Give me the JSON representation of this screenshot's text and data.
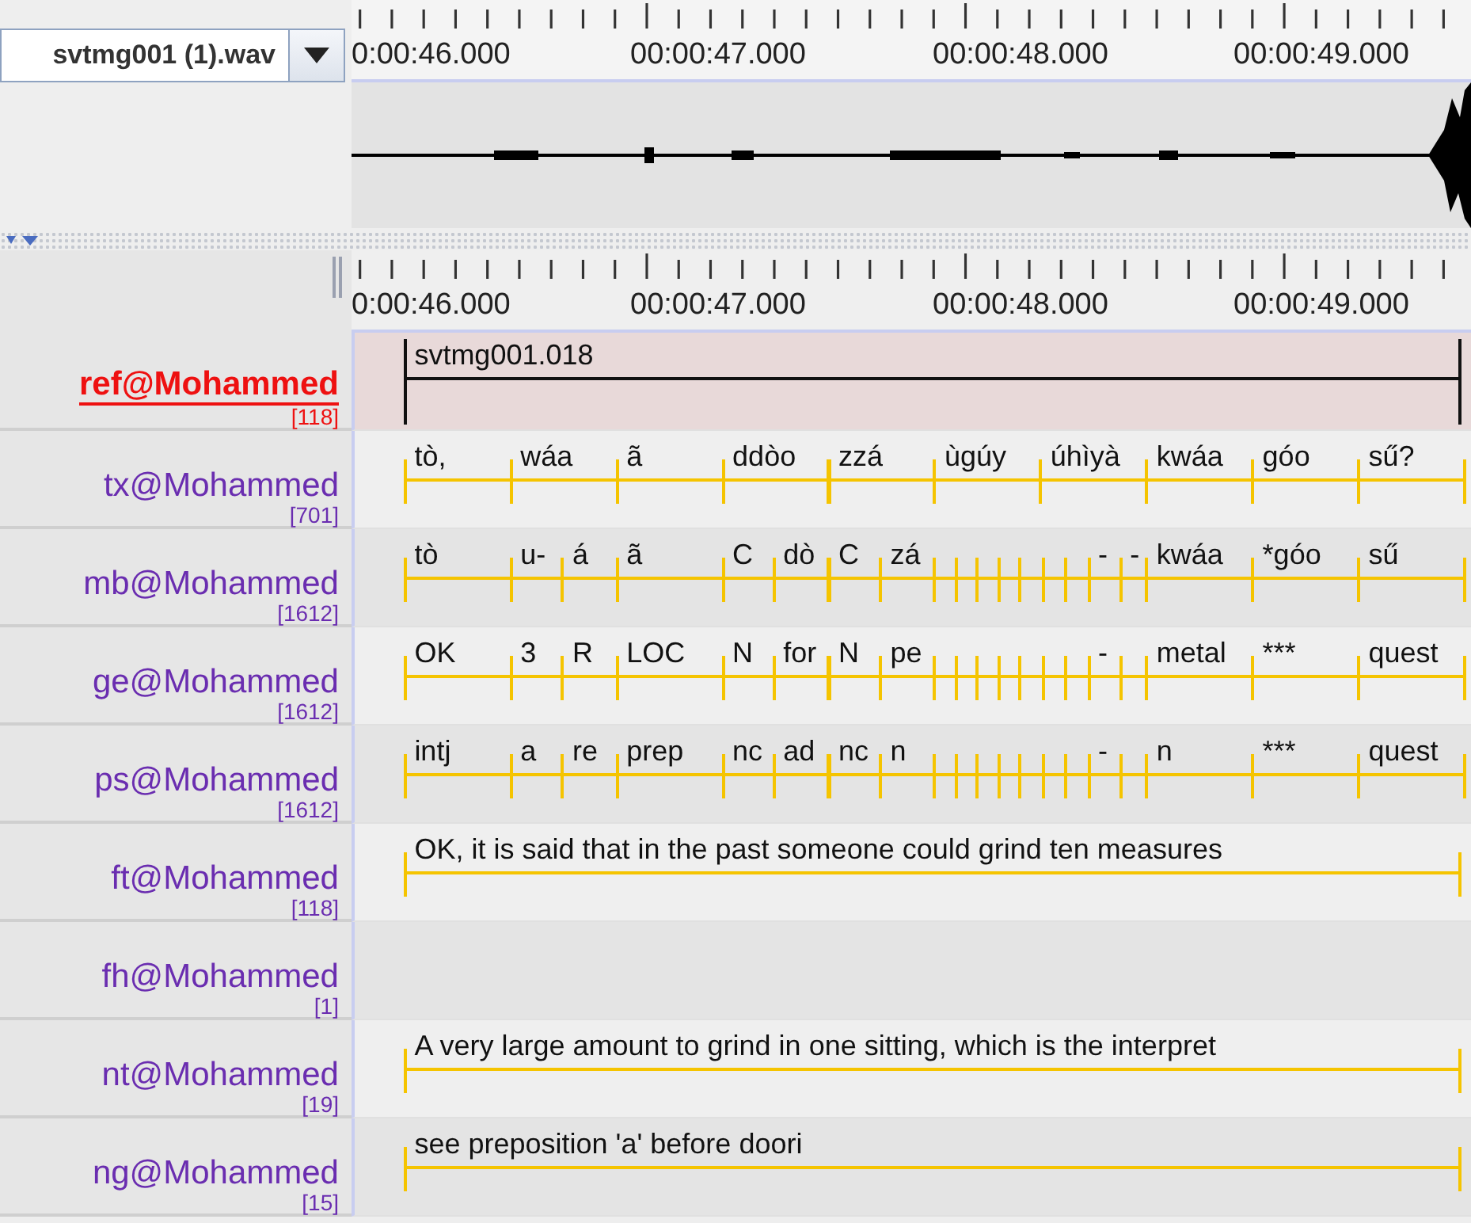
{
  "media_selector": {
    "value": "svtmg001 (1).wav"
  },
  "top_ruler": {
    "labels": [
      "0:00:46.000",
      "00:00:47.000",
      "00:00:48.000",
      "00:00:49.000"
    ]
  },
  "bottom_ruler": {
    "labels": [
      "0:00:46.000",
      "00:00:47.000",
      "00:00:48.000",
      "00:00:49.000"
    ]
  },
  "tiers": [
    {
      "name": "ref@Mohammed",
      "count": "[118]",
      "active": true,
      "kind": "parent",
      "annotations": [
        "svtmg001.018"
      ]
    },
    {
      "name": "tx@Mohammed",
      "count": "[701]",
      "active": false,
      "kind": "child",
      "annotations": [
        "tò,",
        "wáa",
        "ã",
        "ddòo",
        "zzá",
        "ùgúy",
        "úhìyà",
        "kwáa",
        "góo",
        "sű?"
      ]
    },
    {
      "name": "mb@Mohammed",
      "count": "[1612]",
      "active": false,
      "kind": "child",
      "annotations": [
        "tò",
        "u-",
        "á",
        "ã",
        "C",
        "dò",
        "C",
        "zá",
        "-",
        "-",
        "kwáa",
        "*góo",
        "sű"
      ]
    },
    {
      "name": "ge@Mohammed",
      "count": "[1612]",
      "active": false,
      "kind": "child",
      "annotations": [
        "OK",
        "3",
        "R",
        "LOC",
        "N",
        "for",
        "N",
        "pe",
        "-",
        "metal",
        "***",
        "quest"
      ]
    },
    {
      "name": "ps@Mohammed",
      "count": "[1612]",
      "active": false,
      "kind": "child",
      "annotations": [
        "intj",
        "a",
        "re",
        "prep",
        "nc",
        "ad",
        "nc",
        "n",
        "-",
        "n",
        "***",
        "quest"
      ]
    },
    {
      "name": "ft@Mohammed",
      "count": "[118]",
      "active": false,
      "kind": "child",
      "annotations": [
        "OK, it is said that in the past someone could grind ten measures"
      ]
    },
    {
      "name": "fh@Mohammed",
      "count": "[1]",
      "active": false,
      "kind": "child"
    },
    {
      "name": "nt@Mohammed",
      "count": "[19]",
      "active": false,
      "kind": "child",
      "annotations": [
        "A very large amount to grind in one sitting, which is the interpret"
      ]
    },
    {
      "name": "ng@Mohammed",
      "count": "[15]",
      "active": false,
      "kind": "child",
      "annotations": [
        "see preposition 'a' before doori"
      ]
    }
  ]
}
